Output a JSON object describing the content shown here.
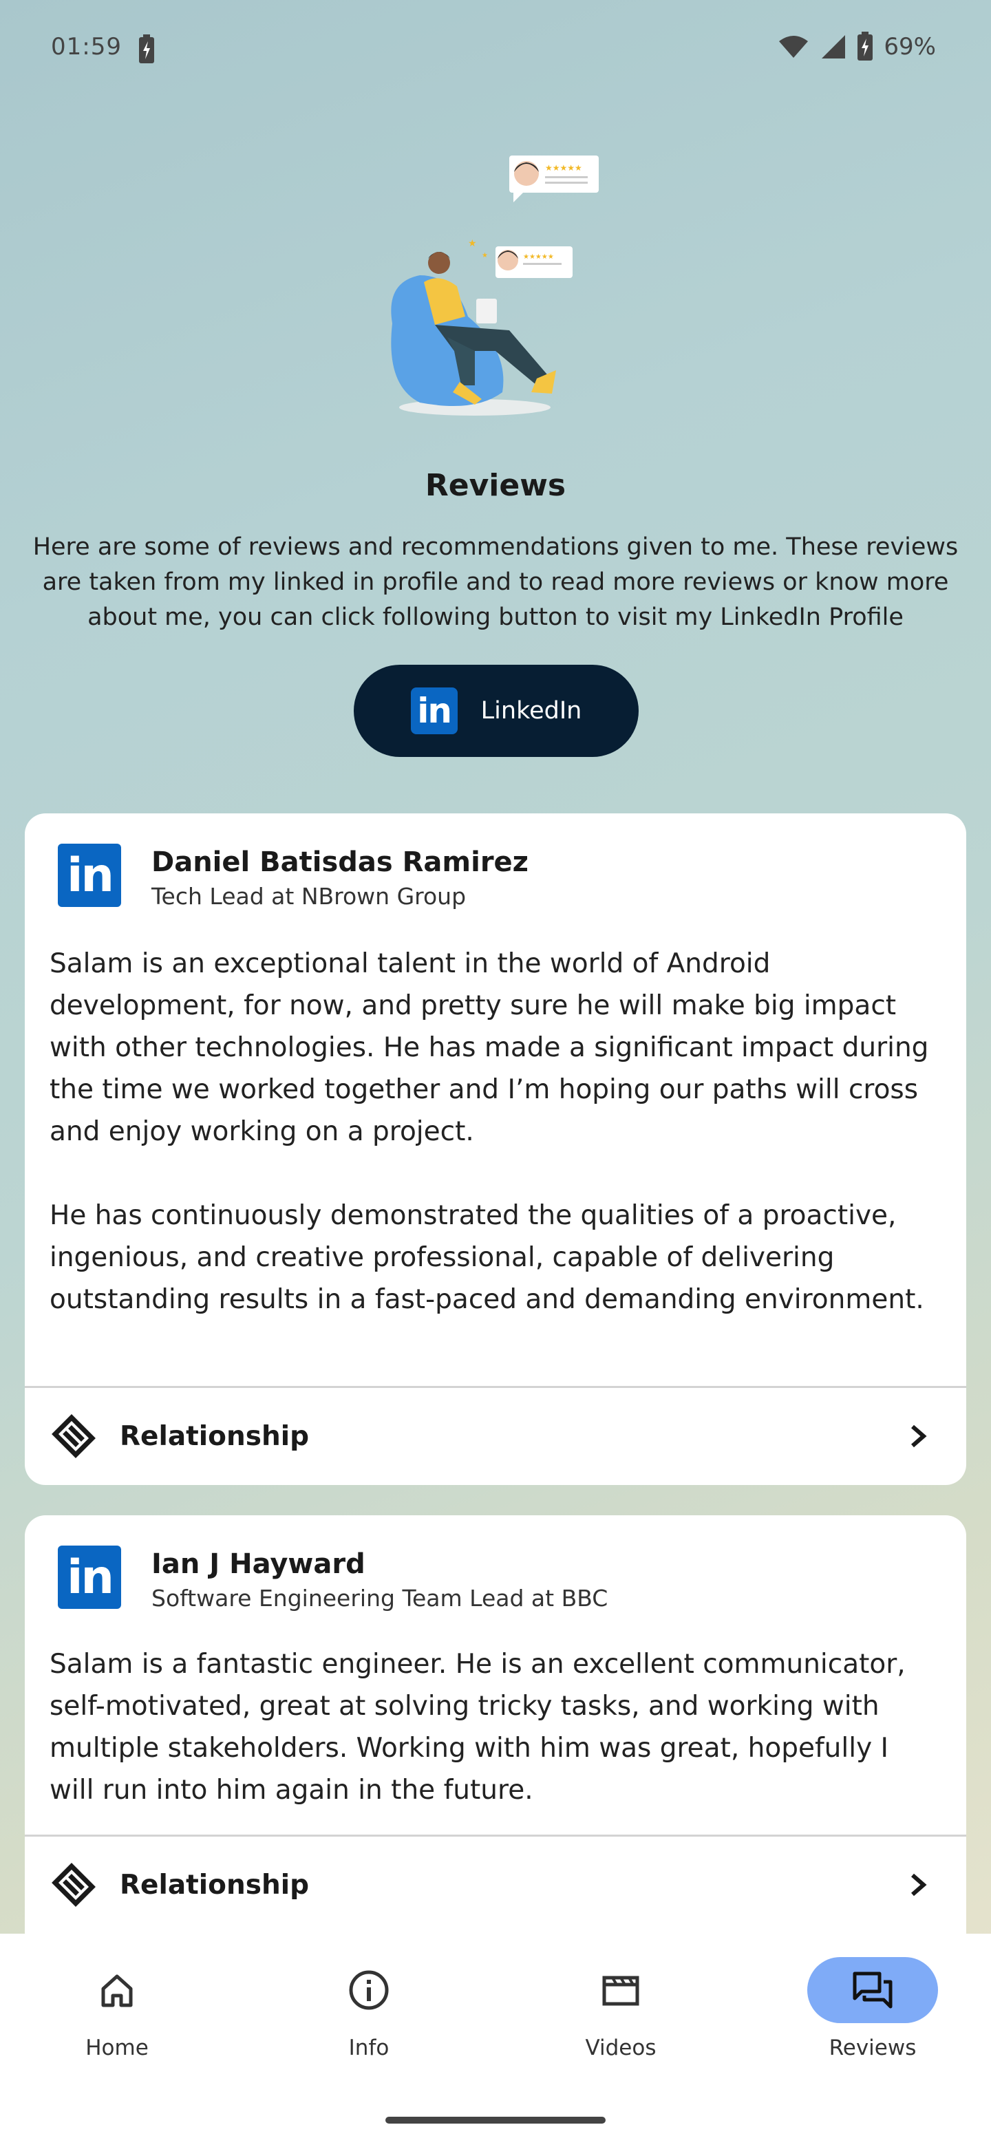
{
  "status_bar": {
    "time": "01:59",
    "battery_percent": "69%",
    "icons": [
      "charging-bolt-icon",
      "wifi-icon",
      "signal-icon",
      "battery-icon"
    ]
  },
  "page": {
    "title": "Reviews",
    "intro": "Here are some of reviews and recommendations given to me. These reviews are taken from my linked in profile and to read more reviews or know more about me, you can click following button to visit my LinkedIn Profile",
    "linkedin_button_label": "LinkedIn",
    "linkedin_logo_text": "in"
  },
  "reviews": [
    {
      "name": "Daniel Batisdas Ramirez",
      "role": "Tech Lead at NBrown Group",
      "text": "Salam is an exceptional talent in the world of Android development, for now, and pretty sure he will make big impact with other technologies. He has made a significant impact during the time we worked together and I’m hoping our paths will cross and enjoy working on a project.\n\n He has continuously demonstrated the qualities of a proactive, ingenious, and creative professional, capable of delivering outstanding results in a fast-paced and demanding environment.",
      "footer_label": "Relationship"
    },
    {
      "name": "Ian J Hayward",
      "role": "Software Engineering Team Lead at BBC",
      "text": "Salam is a fantastic engineer. He is an excellent communicator, self-motivated, great at solving tricky tasks, and working with multiple stakeholders. Working with him was great, hopefully I will run into him again in the future.",
      "footer_label": "Relationship"
    }
  ],
  "bottom_nav": {
    "items": [
      {
        "label": "Home",
        "icon": "home-icon"
      },
      {
        "label": "Info",
        "icon": "info-icon"
      },
      {
        "label": "Videos",
        "icon": "clapperboard-icon"
      },
      {
        "label": "Reviews",
        "icon": "chat-bubbles-icon"
      }
    ],
    "active": "Reviews"
  },
  "colors": {
    "linkedin_blue": "#0a66c2",
    "button_dark": "#071e33",
    "nav_active_pill": "#7fabf7"
  }
}
